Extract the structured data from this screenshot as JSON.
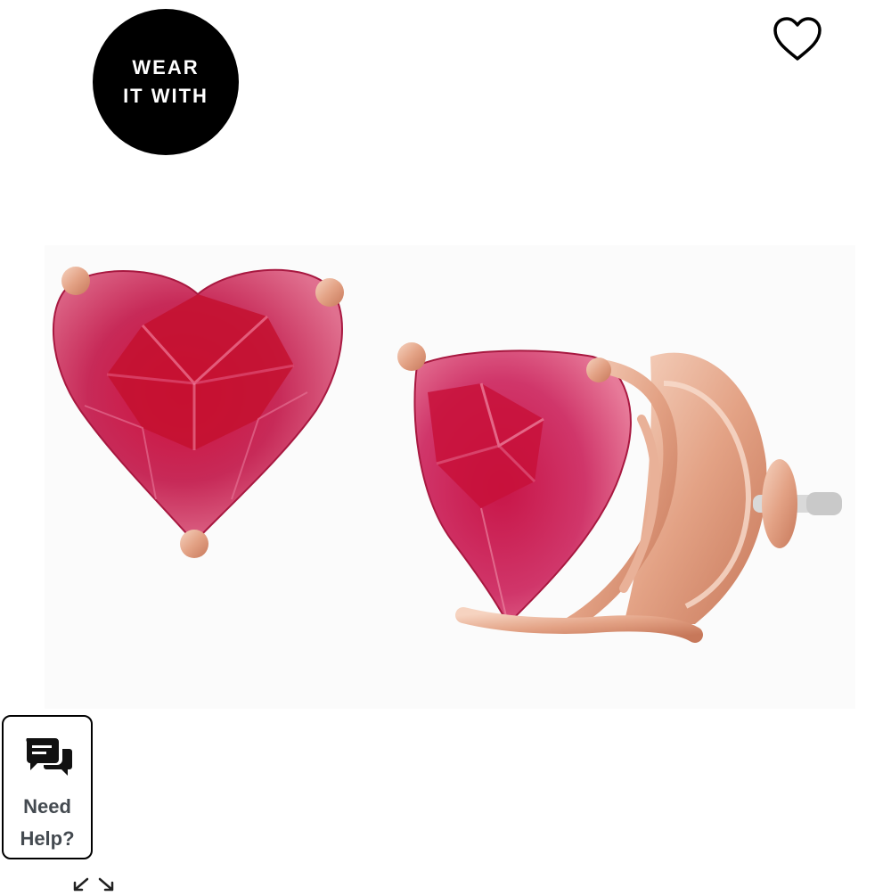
{
  "badge": {
    "line1": "WEAR",
    "line2": "IT WITH",
    "color": "#000000"
  },
  "wishlist": {
    "icon": "heart-outline-icon"
  },
  "help": {
    "icon": "chat-bubbles-icon",
    "line1": "Need",
    "line2": "Help?",
    "text_color": "#444a50"
  },
  "expand": {
    "icon": "expand-arrows-icon"
  },
  "colors": {
    "gem": "#c8194a",
    "gem_light": "#e8557a",
    "setting": "#e8b39a"
  }
}
